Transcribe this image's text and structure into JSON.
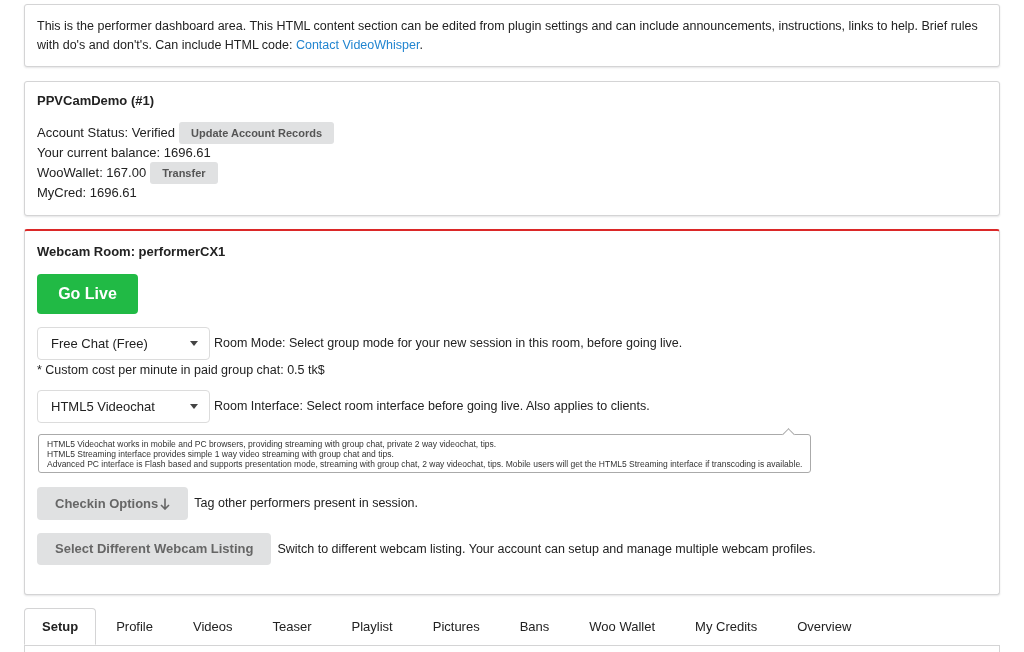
{
  "intro": {
    "text": "This is the performer dashboard area. This HTML content section can be edited from plugin settings and can include announcements, instructions, links to help. Brief rules with do's and don't's. Can include HTML code:",
    "link": "Contact VideoWhisper",
    "text_after": "."
  },
  "account": {
    "title": "PPVCamDemo (#1)",
    "rows": [
      {
        "label": "Account Status: Verified",
        "button": "Update Account Records"
      },
      {
        "label": "Your current balance: 1696.61"
      },
      {
        "label": "WooWallet: 167.00",
        "button": "Transfer"
      },
      {
        "label": "MyCred: 1696.61"
      }
    ]
  },
  "room": {
    "title": "Webcam Room: performerCX1",
    "go_live": "Go Live",
    "room_mode": {
      "value": "Free Chat (Free)",
      "description": "Room Mode: Select group mode for your new session in this room, before going live."
    },
    "cost_note": "* Custom cost per minute in paid group chat: 0.5 tk$",
    "room_interface": {
      "value": "HTML5 Videochat",
      "description": "Room Interface: Select room interface before going live. Also applies to clients."
    },
    "interface_help": [
      "HTML5 Videochat works in mobile and PC browsers, providing streaming with group chat, private 2 way videochat, tips.",
      "HTML5 Streaming interface provides simple 1 way video streaming with group chat and tips.",
      "Advanced PC interface is Flash based and supports presentation mode, streaming with group chat, 2 way videochat, tips. Mobile users will get the HTML5 Streaming interface if transcoding is available."
    ],
    "checkin": {
      "button": "Checkin Options",
      "description": "Tag other performers present in session."
    },
    "listing": {
      "button": "Select Different Webcam Listing",
      "description": "Switch to different webcam listing. Your account can setup and manage multiple webcam profiles."
    }
  },
  "tabs": [
    {
      "label": "Setup",
      "selected": true
    },
    {
      "label": "Profile",
      "selected": false
    },
    {
      "label": "Videos",
      "selected": false
    },
    {
      "label": "Teaser",
      "selected": false
    },
    {
      "label": "Playlist",
      "selected": false
    },
    {
      "label": "Pictures",
      "selected": false
    },
    {
      "label": "Bans",
      "selected": false
    },
    {
      "label": "Woo Wallet",
      "selected": false
    },
    {
      "label": "My Credits",
      "selected": false
    },
    {
      "label": "Overview",
      "selected": false
    }
  ]
}
